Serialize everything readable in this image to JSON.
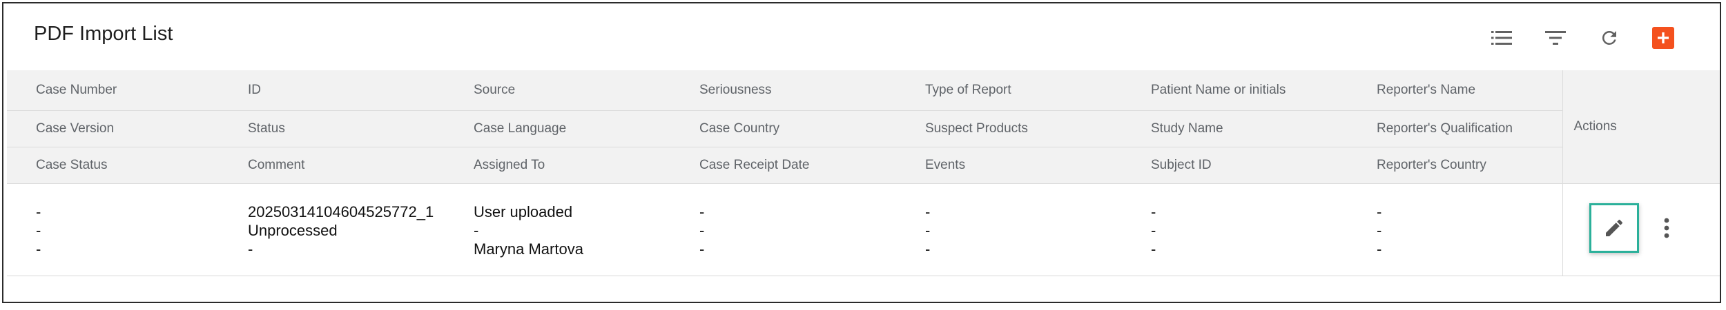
{
  "header": {
    "title": "PDF Import List"
  },
  "toolbar": {
    "icons": [
      "list-view-icon",
      "filter-icon",
      "refresh-icon",
      "add-icon"
    ],
    "accent": "#f4511e"
  },
  "table": {
    "header_rows": [
      [
        "Case Number",
        "ID",
        "Source",
        "Seriousness",
        "Type of Report",
        "Patient Name or initials",
        "Reporter's Name"
      ],
      [
        "Case Version",
        "Status",
        "Case Language",
        "Case Country",
        "Suspect Products",
        "Study Name",
        "Reporter's Qualification"
      ],
      [
        "Case Status",
        "Comment",
        "Assigned To",
        "Case Receipt Date",
        "Events",
        "Subject ID",
        "Reporter's Country"
      ]
    ],
    "actions_header": "Actions",
    "rows": [
      {
        "cells": [
          [
            "-",
            "-",
            "-"
          ],
          [
            "20250314104604525772_1",
            "Unprocessed",
            "-"
          ],
          [
            "User uploaded",
            "-",
            "Maryna Martova"
          ],
          [
            "-",
            "-",
            "-"
          ],
          [
            "-",
            "-",
            "-"
          ],
          [
            "-",
            "-",
            "-"
          ],
          [
            "-",
            "-",
            "-"
          ]
        ]
      }
    ],
    "highlight_color": "#2bb09a"
  }
}
